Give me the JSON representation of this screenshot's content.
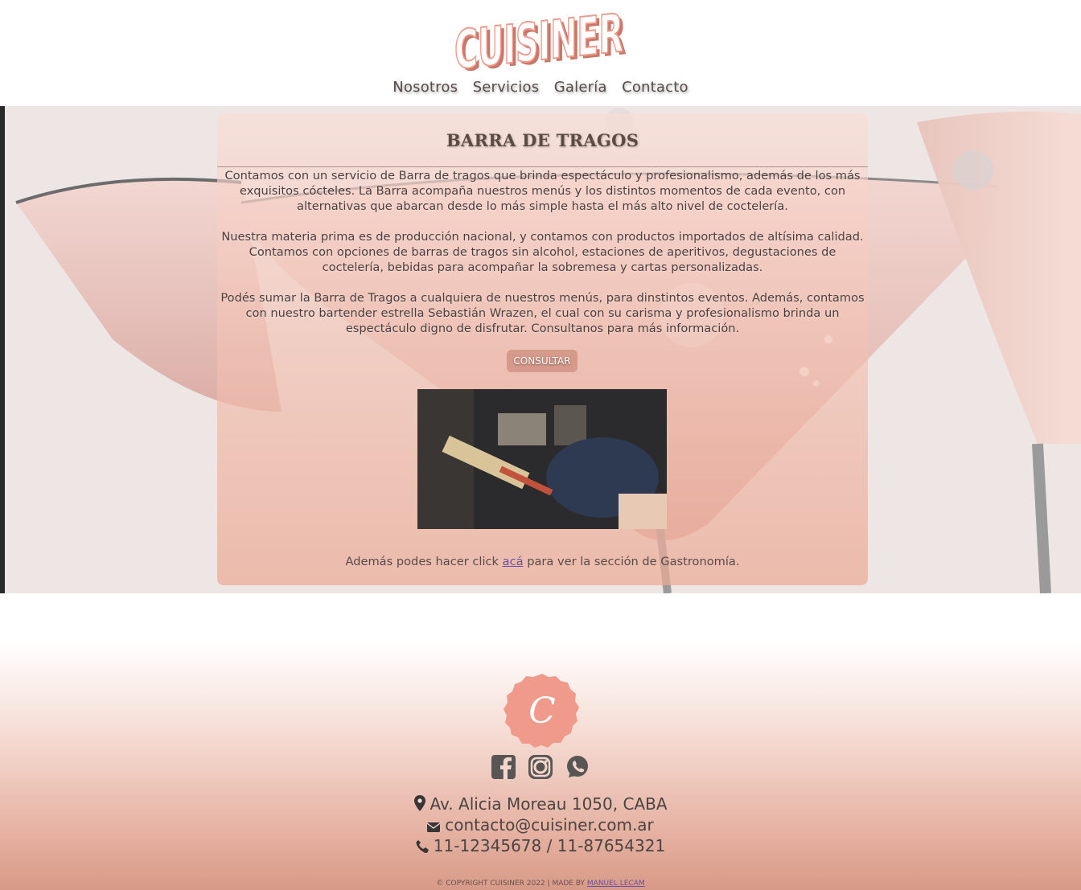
{
  "brand": {
    "logo_text": "CUISINER",
    "accent": "#ef9a8a"
  },
  "nav": {
    "items": [
      {
        "label": "Nosotros"
      },
      {
        "label": "Servicios"
      },
      {
        "label": "Galería"
      },
      {
        "label": "Contacto"
      }
    ]
  },
  "card": {
    "title": "BARRA DE TRAGOS",
    "paragraphs": [
      "Contamos con un servicio de Barra de tragos que brinda espectáculo y profesionalismo, además de los más exquisitos cócteles. La Barra acompaña nuestros menús y los distintos momentos de cada evento, con alternativas que abarcan desde lo más simple hasta el más alto nivel de coctelería.",
      "Nuestra materia prima es de producción nacional, y contamos con productos importados de altísima calidad. Contamos con opciones de barras de tragos sin alcohol, estaciones de aperitivos, degustaciones de coctelería, bebidas para acompañar la sobremesa y cartas personalizadas.",
      "Podés sumar la Barra de Tragos a cualquiera de nuestros menús, para dinstintos eventos. Además, contamos con nuestro bartender estrella Sebastián Wrazen, el cual con su carisma y profesionalismo brinda un espectáculo digno de disfrutar. Consultanos para más información."
    ],
    "consult_label": "CONSULTAR",
    "more_prefix": "Además podes hacer click ",
    "more_link": "acá",
    "more_suffix": " para ver la sección de Gastronomía."
  },
  "footer": {
    "seal_letter": "C",
    "social_icons": [
      "facebook-icon",
      "instagram-icon",
      "whatsapp-icon"
    ],
    "address": "Av. Alicia Moreau 1050, CABA",
    "email": "contacto@cuisiner.com.ar",
    "phones": "11-12345678 / 11-87654321",
    "copyright_prefix": "© COPYRIGHT CUISINER 2022 | MADE BY ",
    "author": "MANUEL LECAM"
  }
}
